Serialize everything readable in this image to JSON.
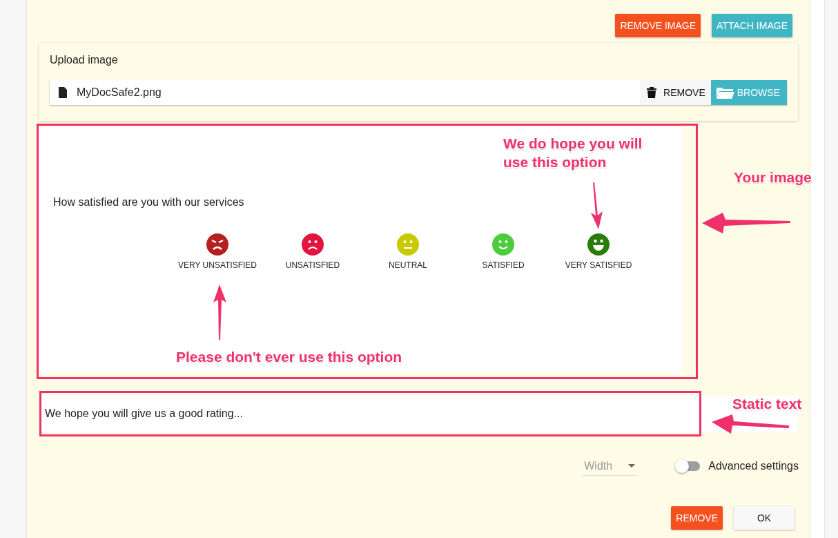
{
  "top_buttons": [
    {
      "label": "REMOVE IMAGE",
      "kind": "danger"
    },
    {
      "label": "ATTACH IMAGE",
      "kind": "info"
    }
  ],
  "upload": {
    "label": "Upload image",
    "file_name": "MyDocSafe2.png",
    "remove": "REMOVE",
    "browse": "BROWSE"
  },
  "image": {
    "question": "How satisfied are you with our services",
    "options": [
      {
        "label": "VERY UNSATISFIED",
        "kind": "angry",
        "color": "#b3201f"
      },
      {
        "label": "UNSATISFIED",
        "kind": "sad",
        "color": "#e3143f"
      },
      {
        "label": "NEUTRAL",
        "kind": "neutral",
        "color": "#c9c900"
      },
      {
        "label": "SATISFIED",
        "kind": "smile",
        "color": "#4ccc3a"
      },
      {
        "label": "VERY SATISFIED",
        "kind": "grin",
        "color": "#2a7d0a"
      }
    ]
  },
  "static_text": "We hope you will give us a good rating...",
  "width_select": {
    "placeholder": "Width"
  },
  "advanced": {
    "label": "Advanced settings",
    "on": false
  },
  "footer_buttons": [
    {
      "label": "REMOVE",
      "kind": "danger"
    },
    {
      "label": "OK",
      "kind": "plain"
    }
  ],
  "annotations": [
    {
      "text": "We do hope you will use this option"
    },
    {
      "text": "Please don't ever use this option"
    },
    {
      "text": "Your image"
    },
    {
      "text": "Static text"
    }
  ]
}
